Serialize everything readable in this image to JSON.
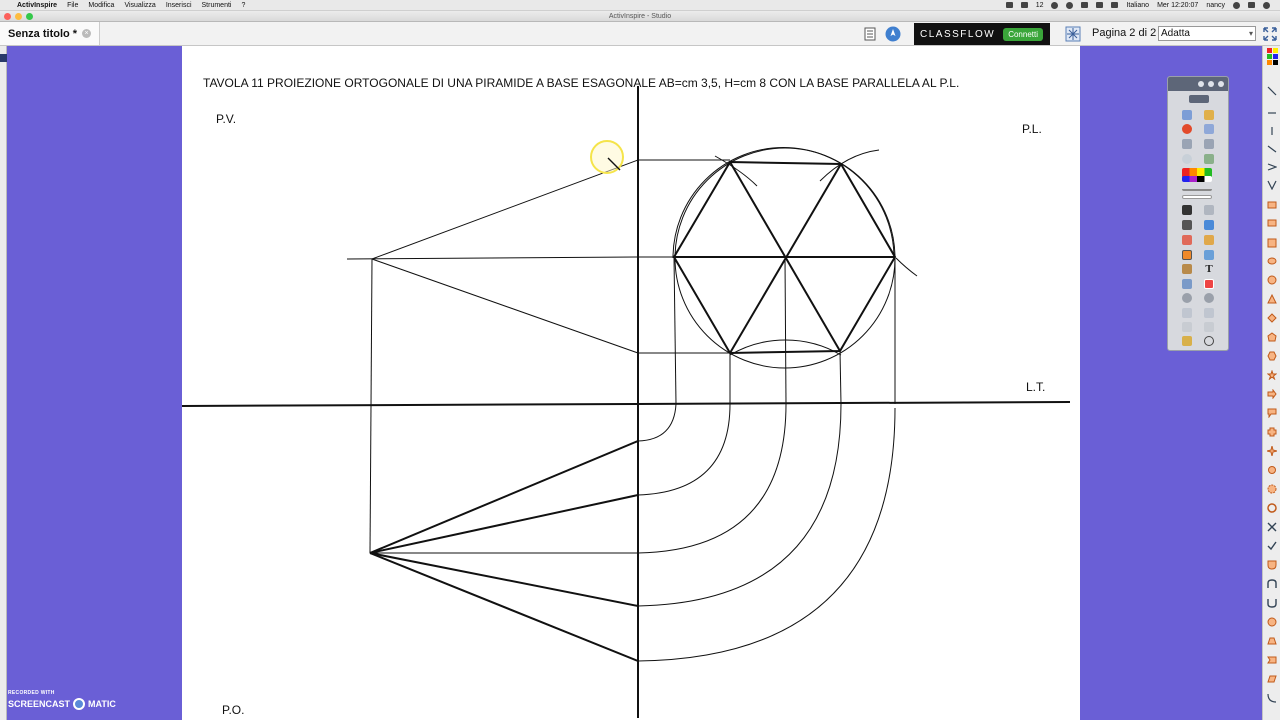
{
  "menubar": {
    "app_name": "ActivInspire",
    "items": [
      "File",
      "Modifica",
      "Visualizza",
      "Inserisci",
      "Strumenti",
      "?"
    ],
    "status_count": "12",
    "language": "Italiano",
    "clock": "Mer 12:20:07",
    "user": "nancy"
  },
  "window": {
    "title": "ActivInspire - Studio"
  },
  "toolbar": {
    "document_tab": "Senza titolo *",
    "classflow_logo": "CLASSFLOW",
    "classflow_connect": "Connetti",
    "page_indicator": "Pagina 2 di 2",
    "zoom_value": "Adatta"
  },
  "page": {
    "title": "TAVOLA 11 PROIEZIONE ORTOGONALE DI UNA PIRAMIDE A BASE ESAGONALE AB=cm 3,5, H=cm 8 CON LA BASE PARALLELA AL P.L.",
    "label_pv": "P.V.",
    "label_pl": "P.L.",
    "label_lt": "L.T.",
    "label_po": "P.O."
  },
  "watermark": {
    "line1": "RECORDED WITH",
    "brand_left": "SCREENCAST",
    "brand_right": "MATIC"
  },
  "colors": {
    "desktop": "#6a5fd6",
    "classflow_bg": "#111111",
    "connect_green": "#3aa63a",
    "pointer_highlight": "#f5e44a"
  },
  "icons": {
    "document_icon": "page-icon",
    "sync_icon": "rocket-icon",
    "fullscreen_icon": "expand-icon"
  }
}
